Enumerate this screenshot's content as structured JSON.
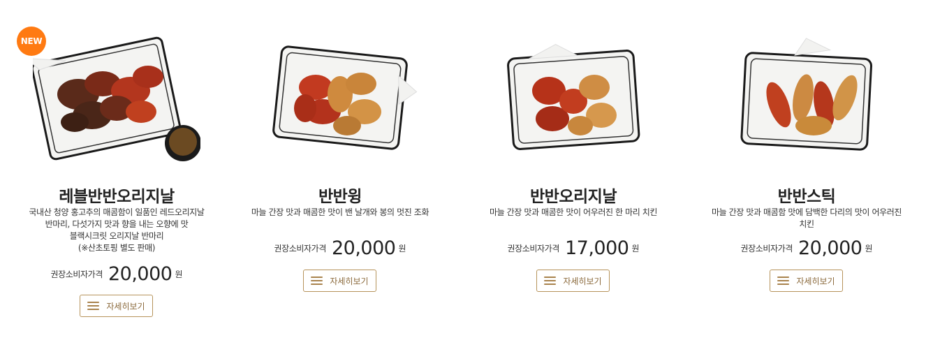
{
  "products": [
    {
      "badge": "NEW",
      "name": "레블반반오리지날",
      "desc_lines": [
        "국내산 청양 홍고추의 매콤함이 일품인 레드오리지날",
        "반마리, 다섯가지 맛과 향을 내는 오향에 맛",
        "블랙시크릿 오리지날 반마리",
        "(※산초토핑 별도 판매)"
      ],
      "price_label": "권장소비자가격",
      "price": "20,000",
      "unit": "원",
      "button_label": "자세히보기"
    },
    {
      "name": "반반윙",
      "desc_lines": [
        "마늘 간장 맛과 매콤한 맛이 밴 날개와 봉의 멋진 조화"
      ],
      "price_label": "권장소비자가격",
      "price": "20,000",
      "unit": "원",
      "button_label": "자세히보기"
    },
    {
      "name": "반반오리지날",
      "desc_lines": [
        "마늘 간장 맛과 매콤한 맛이 어우러진 한 마리 치킨"
      ],
      "price_label": "권장소비자가격",
      "price": "17,000",
      "unit": "원",
      "button_label": "자세히보기"
    },
    {
      "name": "반반스틱",
      "desc_lines": [
        "마늘 간장 맛과 매콤함 맛에 담백한 다리의 맛이 어우러진",
        "치킨"
      ],
      "price_label": "권장소비자가격",
      "price": "20,000",
      "unit": "원",
      "button_label": "자세히보기"
    }
  ],
  "colors": {
    "badge": "#ff7a12",
    "button_border": "#b6935a",
    "button_text": "#8b6a3c",
    "chicken_red": "#b5311a",
    "chicken_golden": "#c98a3a"
  },
  "icons": {
    "button_icon": "hamburger-menu-icon"
  }
}
